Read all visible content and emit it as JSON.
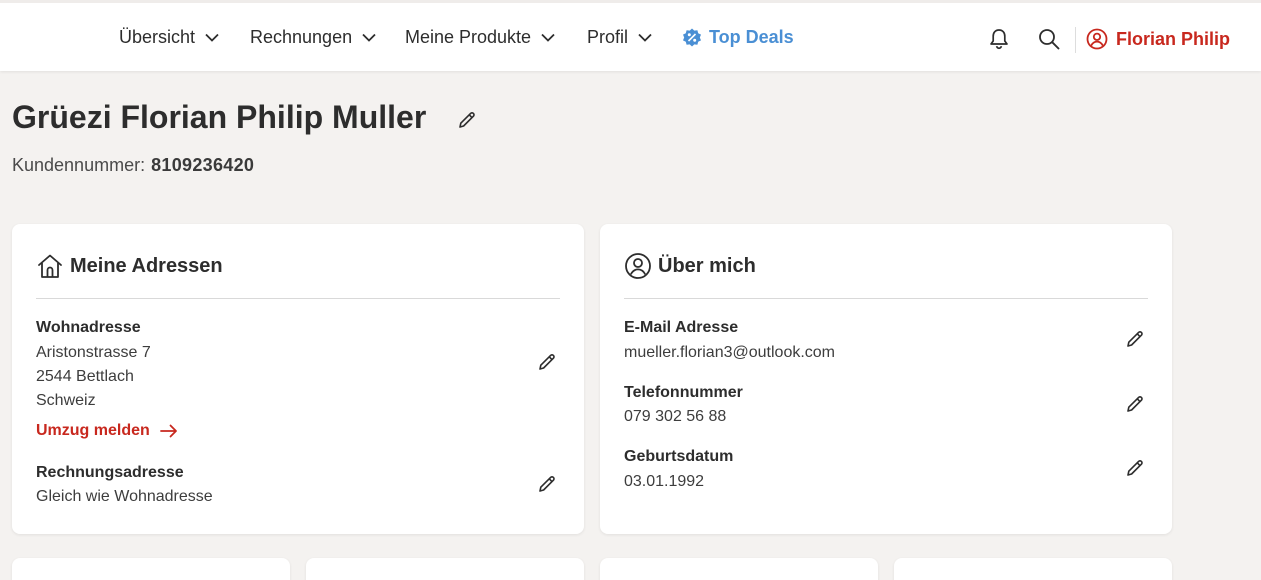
{
  "nav": {
    "items": [
      {
        "label": "Übersicht"
      },
      {
        "label": "Rechnungen"
      },
      {
        "label": "Meine Produkte"
      },
      {
        "label": "Profil"
      }
    ],
    "deals_label": "Top Deals",
    "user_name": "Florian Philip",
    "icons": [
      "bell-icon",
      "search-icon",
      "user-circle-icon",
      "percent-badge-icon",
      "chevron-down-icon"
    ]
  },
  "header": {
    "greeting": "Grüezi Florian Philip Muller",
    "customer_number_label": "Kundennummer:",
    "customer_number": "8109236420"
  },
  "addresses": {
    "title": "Meine Adressen",
    "home_label": "Wohnadresse",
    "home_street": "Aristonstrasse 7",
    "home_city": "2544 Bettlach",
    "home_country": "Schweiz",
    "move_link": "Umzug melden",
    "billing_label": "Rechnungsadresse",
    "billing_value": "Gleich wie Wohnadresse"
  },
  "about": {
    "title": "Über mich",
    "email_label": "E-Mail Adresse",
    "email_value": "mueller.florian3@outlook.com",
    "phone_label": "Telefonnummer",
    "phone_value": "079 302 56 88",
    "birth_label": "Geburtsdatum",
    "birth_value": "03.01.1992"
  },
  "colors": {
    "accent_red": "#c8281e",
    "deals_blue": "#4a8fd4",
    "background": "#f4f2f0"
  }
}
